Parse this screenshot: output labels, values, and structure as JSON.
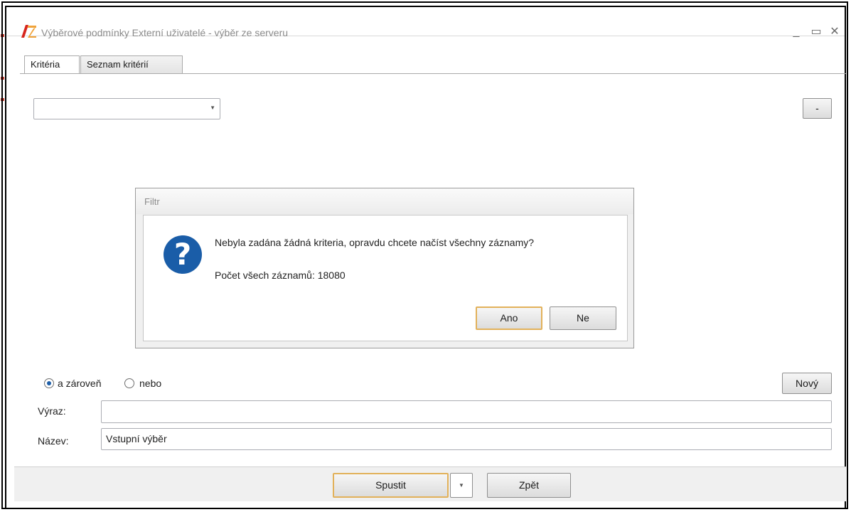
{
  "window": {
    "title": "Výběrové podmínky Externí uživatelé - výběr ze serveru",
    "minimize_glyph": "_",
    "maximize_glyph": "▭",
    "close_glyph": "✕"
  },
  "tabs": [
    {
      "label": "Kritéria",
      "active": true
    },
    {
      "label": "Seznam kritérií",
      "active": false
    }
  ],
  "criteria": {
    "combo_value": "",
    "remove_button_label": "-"
  },
  "dialog": {
    "title": "Filtr",
    "icon": "question-icon",
    "message": "Nebyla zadána žádná kriteria, opravdu chcete načíst všechny záznamy?",
    "count_text": "Počet všech záznamů: 18080",
    "yes_label": "Ano",
    "no_label": "Ne"
  },
  "logic": {
    "and_label": "a zároveň",
    "or_label": "nebo",
    "selected": "and"
  },
  "new_button_label": "Nový",
  "fields": {
    "expression_label": "Výraz:",
    "expression_value": "",
    "name_label": "Název:",
    "name_value": "Vstupní výběr"
  },
  "footer": {
    "run_label": "Spustit",
    "back_label": "Zpět"
  },
  "colors": {
    "accent_focus": "#e2b15a",
    "question_icon": "#1a5da8",
    "logo_red": "#d7261e"
  }
}
